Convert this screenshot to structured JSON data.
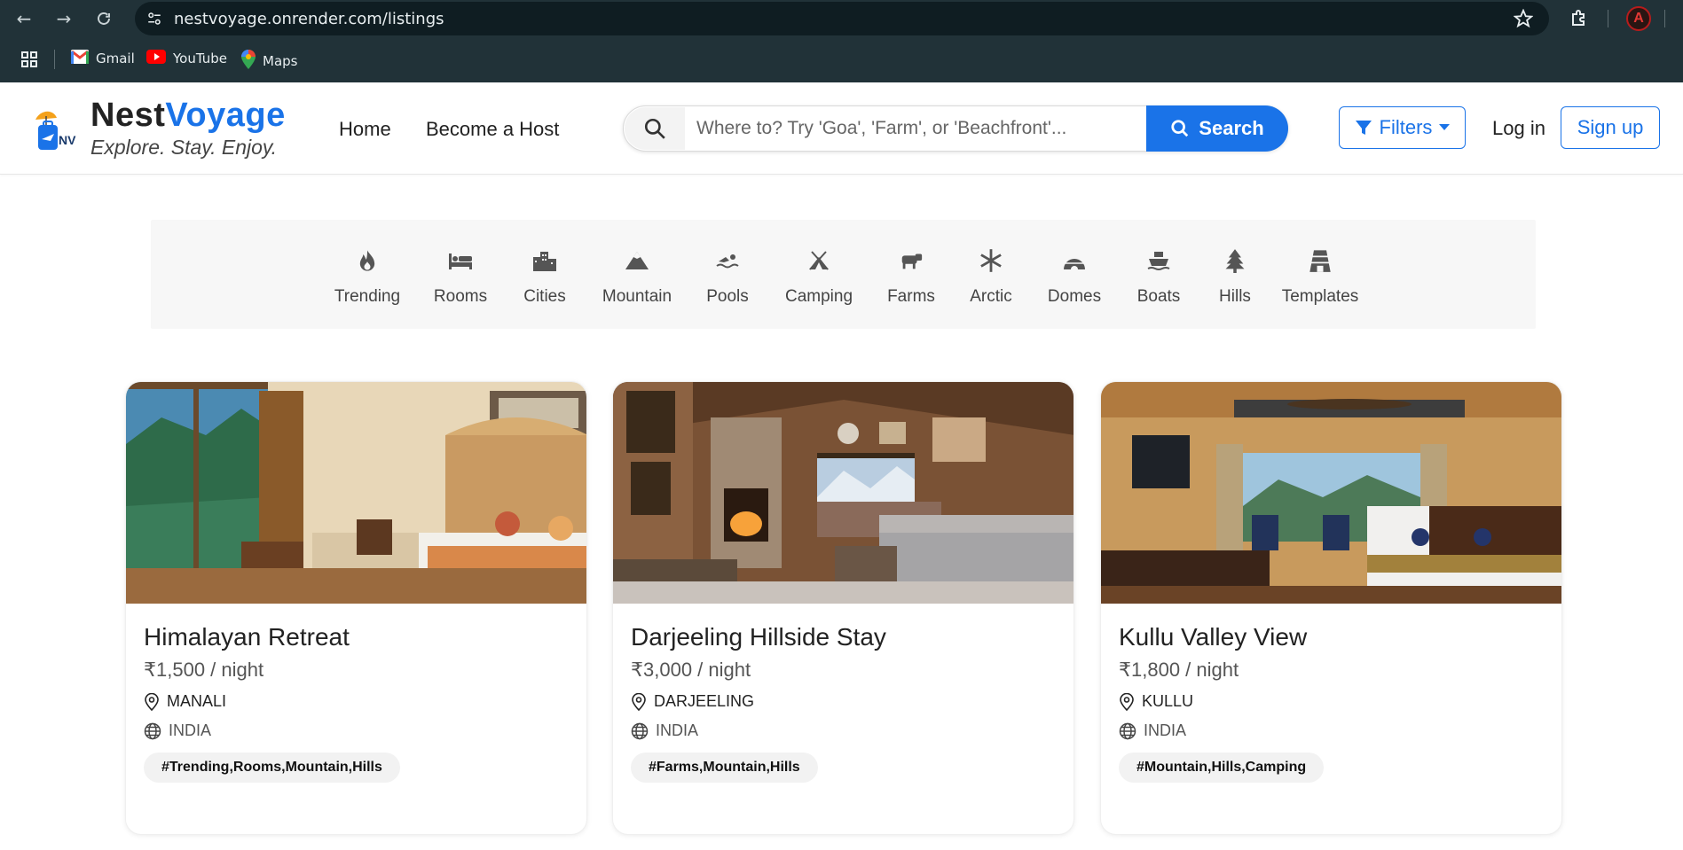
{
  "browser": {
    "url": "nestvoyage.onrender.com/listings",
    "bookmarks": [
      {
        "label": "Gmail",
        "icon": "gmail-icon"
      },
      {
        "label": "YouTube",
        "icon": "youtube-icon"
      },
      {
        "label": "Maps",
        "icon": "maps-icon"
      }
    ],
    "profile_initial": "A"
  },
  "navbar": {
    "brand_part1": "Nest",
    "brand_part2": "Voyage",
    "logo_text": "NV",
    "tagline": "Explore. Stay. Enjoy.",
    "links": [
      "Home",
      "Become a Host"
    ],
    "search_placeholder": "Where to? Try 'Goa', 'Farm', or 'Beachfront'...",
    "search_button": "Search",
    "filters_button": "Filters",
    "login": "Log in",
    "signup": "Sign up",
    "accent_color": "#1a73e8"
  },
  "categories": [
    {
      "label": "Trending",
      "icon": "fire-icon"
    },
    {
      "label": "Rooms",
      "icon": "bed-icon"
    },
    {
      "label": "Cities",
      "icon": "city-icon"
    },
    {
      "label": "Mountain",
      "icon": "mountain-icon"
    },
    {
      "label": "Pools",
      "icon": "swimmer-icon"
    },
    {
      "label": "Camping",
      "icon": "tent-icon"
    },
    {
      "label": "Farms",
      "icon": "cow-icon"
    },
    {
      "label": "Arctic",
      "icon": "snowflake-icon"
    },
    {
      "label": "Domes",
      "icon": "igloo-icon"
    },
    {
      "label": "Boats",
      "icon": "ship-icon"
    },
    {
      "label": "Hills",
      "icon": "tree-icon"
    },
    {
      "label": "Templates",
      "icon": "gopuram-icon"
    }
  ],
  "listings": [
    {
      "title": "Himalayan Retreat",
      "price": "₹1,500 / night",
      "location": "MANALI",
      "country": "INDIA",
      "tags": "#Trending,Rooms,Mountain,Hills"
    },
    {
      "title": "Darjeeling Hillside Stay",
      "price": "₹3,000 / night",
      "location": "DARJEELING",
      "country": "INDIA",
      "tags": "#Farms,Mountain,Hills"
    },
    {
      "title": "Kullu Valley View",
      "price": "₹1,800 / night",
      "location": "KULLU",
      "country": "INDIA",
      "tags": "#Mountain,Hills,Camping"
    }
  ]
}
